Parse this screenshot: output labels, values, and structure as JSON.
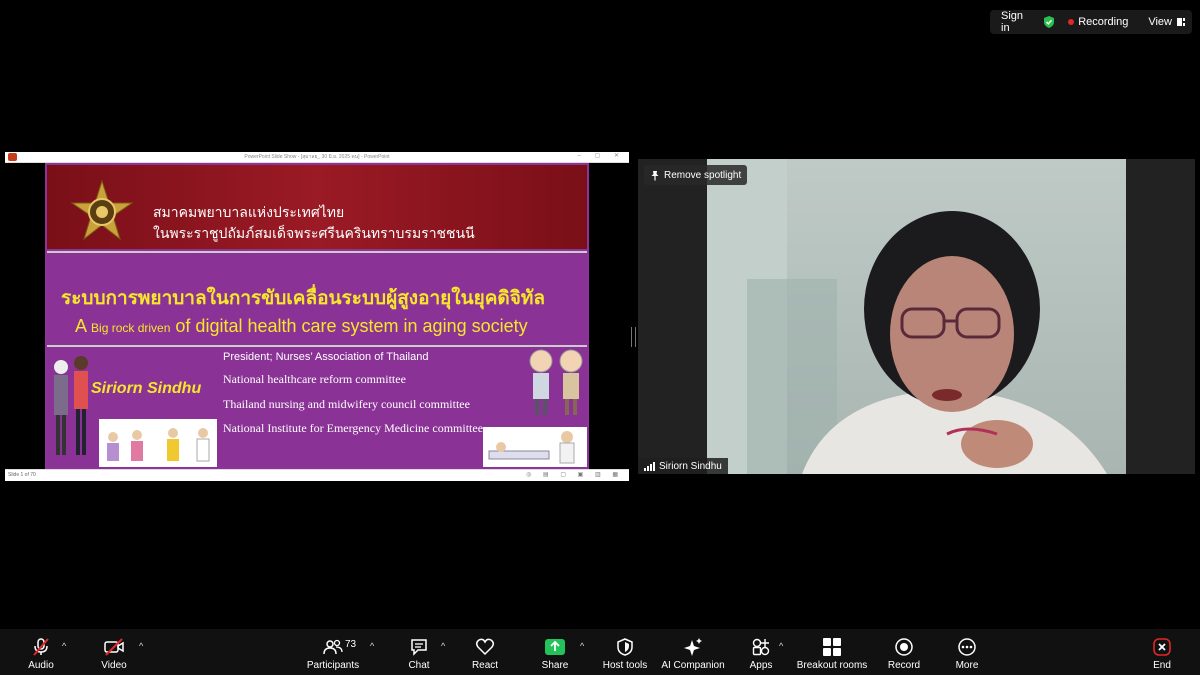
{
  "topbar": {
    "sign_in": "Sign in",
    "recording": "Recording",
    "view": "View",
    "colors": {
      "shield": "#2bbf4f",
      "rec": "#e02828"
    }
  },
  "share": {
    "window_title": "PowerPoint Slide Show - [สุมาลย_ 30 มิ.ย. 2025 คน] - PowerPoint",
    "slide_indicator": "Slide 1 of 70",
    "slide": {
      "assoc_line1": "สมาคมพยาบาลแห่งประเทศไทย",
      "assoc_line2": "ในพระราชูปถัมภ์สมเด็จพระศรีนครินทราบรมราชชนนี",
      "title_th": "ระบบการพยาบาลในการขับเคลื่อนระบบผู้สูงอายุในยุคดิจิทัล",
      "title_en_a": "A",
      "title_en_small": "Big rock driven",
      "title_en_rest": "of digital health care system in aging society",
      "speaker": "Siriorn Sindhu",
      "roles": [
        "President; Nurses’ Association of Thailand",
        "National healthcare reform committee",
        "Thailand nursing and midwifery council committee",
        "National Institute for Emergency Medicine committee"
      ]
    }
  },
  "video": {
    "remove_spotlight": "Remove spotlight",
    "participant_name": "Siriorn Sindhu"
  },
  "toolbar": {
    "audio": "Audio",
    "video": "Video",
    "participants": "Participants",
    "participants_count": "73",
    "chat": "Chat",
    "react": "React",
    "share": "Share",
    "host_tools": "Host tools",
    "ai_companion": "AI Companion",
    "apps": "Apps",
    "breakout_rooms": "Breakout rooms",
    "record": "Record",
    "more": "More",
    "end": "End",
    "colors": {
      "share_green": "#23c25a",
      "end_red": "#e02828",
      "muted_red": "#e02828"
    }
  }
}
